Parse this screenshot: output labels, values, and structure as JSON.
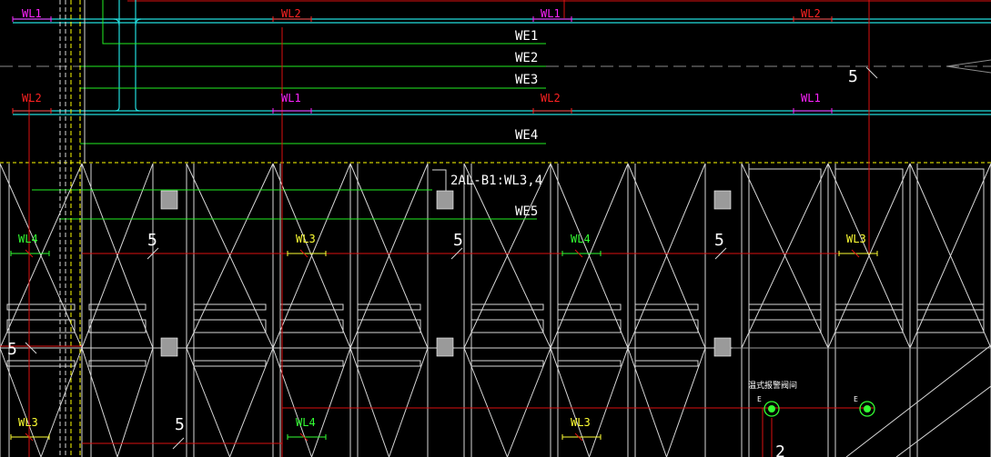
{
  "colors": {
    "background": "#000000",
    "wl1": "#ff22ff",
    "wl2": "#ff2222",
    "wl3": "#ffff33",
    "wl4": "#33ff33",
    "we": "#ffffff",
    "bus_green": "#22ee22",
    "bus_cyan": "#22dddd",
    "grid_white": "#d8d8d8",
    "dashed_yellow": "#ffff00",
    "dim_grey": "#8a8a8a",
    "column_grey": "#9a9a9a",
    "red_line": "#dd1111"
  },
  "labels": {
    "wl1_a": "WL1",
    "wl2_a": "WL2",
    "wl1_b": "WL1",
    "wl2_b": "WL2",
    "wl2_c": "WL2",
    "wl1_c": "WL1",
    "wl2_d": "WL2",
    "wl1_d": "WL1",
    "we1": "WE1",
    "we2": "WE2",
    "we3": "WE3",
    "we4": "WE4",
    "we5": "WE5",
    "panel_ref": "2AL-B1:WL3,4",
    "num5_top": "5",
    "num5_a": "5",
    "num5_b": "5",
    "num5_c": "5",
    "num5_left": "5",
    "num5_bottom": "5",
    "wl4_a": "WL4",
    "wl3_a": "WL3",
    "wl4_b": "WL4",
    "wl3_b": "WL3",
    "wl3_c": "WL3",
    "wl4_c": "WL4",
    "wl3_d": "WL3",
    "fixture_caption": "温式报警阀间",
    "e_a": "E",
    "e_b": "E",
    "num2": "2"
  }
}
